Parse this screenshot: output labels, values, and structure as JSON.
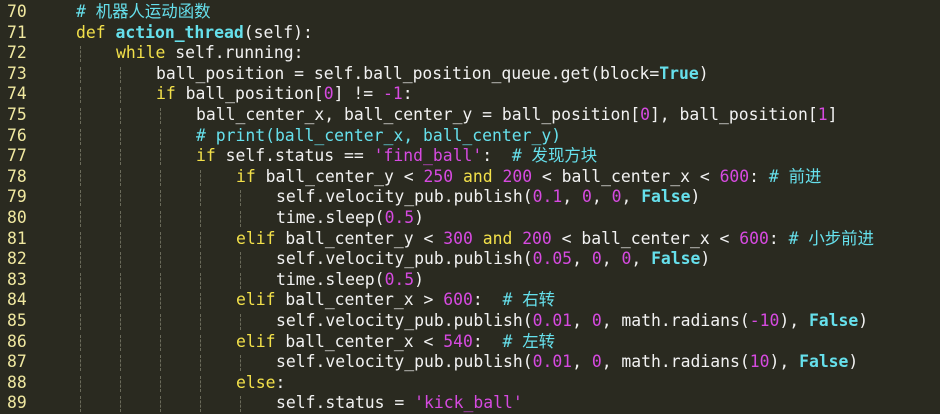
{
  "editor": {
    "colors": {
      "background": "#2a2a20",
      "line_number": "#f0e8a0",
      "keyword": "#f2e04a",
      "function": "#66e0ec",
      "constant": "#66e0ec",
      "number": "#d64ae0",
      "string": "#d64ae0",
      "comment": "#66e0ec",
      "text": "#f2f2f2"
    },
    "lines": [
      {
        "num": "70",
        "indent": 0,
        "tokens": [
          {
            "t": "cm",
            "v": "# 机器人运动函数"
          }
        ]
      },
      {
        "num": "71",
        "indent": 0,
        "tokens": [
          {
            "t": "kw",
            "v": "def "
          },
          {
            "t": "fn",
            "v": "action_thread"
          },
          {
            "t": "plain",
            "v": "(self):"
          }
        ]
      },
      {
        "num": "72",
        "indent": 1,
        "tokens": [
          {
            "t": "kw",
            "v": "while "
          },
          {
            "t": "plain",
            "v": "self.running:"
          }
        ]
      },
      {
        "num": "73",
        "indent": 2,
        "tokens": [
          {
            "t": "plain",
            "v": "ball_position = self.ball_position_queue.get(block="
          },
          {
            "t": "const",
            "v": "True"
          },
          {
            "t": "plain",
            "v": ")"
          }
        ]
      },
      {
        "num": "74",
        "indent": 2,
        "tokens": [
          {
            "t": "kw",
            "v": "if "
          },
          {
            "t": "plain",
            "v": "ball_position["
          },
          {
            "t": "num",
            "v": "0"
          },
          {
            "t": "plain",
            "v": "] != "
          },
          {
            "t": "num",
            "v": "-1"
          },
          {
            "t": "plain",
            "v": ":"
          }
        ]
      },
      {
        "num": "75",
        "indent": 3,
        "tokens": [
          {
            "t": "plain",
            "v": "ball_center_x, ball_center_y = ball_position["
          },
          {
            "t": "num",
            "v": "0"
          },
          {
            "t": "plain",
            "v": "], ball_position["
          },
          {
            "t": "num",
            "v": "1"
          },
          {
            "t": "plain",
            "v": "]"
          }
        ]
      },
      {
        "num": "76",
        "indent": 3,
        "tokens": [
          {
            "t": "cm",
            "v": "# print(ball_center_x, ball_center_y)"
          }
        ]
      },
      {
        "num": "77",
        "indent": 3,
        "tokens": [
          {
            "t": "kw",
            "v": "if "
          },
          {
            "t": "plain",
            "v": "self.status == "
          },
          {
            "t": "str",
            "v": "'find_ball'"
          },
          {
            "t": "plain",
            "v": ":  "
          },
          {
            "t": "cm",
            "v": "# 发现方块"
          }
        ]
      },
      {
        "num": "78",
        "indent": 4,
        "tokens": [
          {
            "t": "kw",
            "v": "if "
          },
          {
            "t": "plain",
            "v": "ball_center_y < "
          },
          {
            "t": "num",
            "v": "250"
          },
          {
            "t": "kw",
            "v": " and "
          },
          {
            "t": "num",
            "v": "200"
          },
          {
            "t": "plain",
            "v": " < ball_center_x < "
          },
          {
            "t": "num",
            "v": "600"
          },
          {
            "t": "plain",
            "v": ": "
          },
          {
            "t": "cm",
            "v": "# 前进"
          }
        ]
      },
      {
        "num": "79",
        "indent": 5,
        "tokens": [
          {
            "t": "plain",
            "v": "self.velocity_pub.publish("
          },
          {
            "t": "num",
            "v": "0.1"
          },
          {
            "t": "plain",
            "v": ", "
          },
          {
            "t": "num",
            "v": "0"
          },
          {
            "t": "plain",
            "v": ", "
          },
          {
            "t": "num",
            "v": "0"
          },
          {
            "t": "plain",
            "v": ", "
          },
          {
            "t": "const",
            "v": "False"
          },
          {
            "t": "plain",
            "v": ")"
          }
        ]
      },
      {
        "num": "80",
        "indent": 5,
        "tokens": [
          {
            "t": "plain",
            "v": "time.sleep("
          },
          {
            "t": "num",
            "v": "0.5"
          },
          {
            "t": "plain",
            "v": ")"
          }
        ]
      },
      {
        "num": "81",
        "indent": 4,
        "tokens": [
          {
            "t": "kw",
            "v": "elif "
          },
          {
            "t": "plain",
            "v": "ball_center_y < "
          },
          {
            "t": "num",
            "v": "300"
          },
          {
            "t": "kw",
            "v": " and "
          },
          {
            "t": "num",
            "v": "200"
          },
          {
            "t": "plain",
            "v": " < ball_center_x < "
          },
          {
            "t": "num",
            "v": "600"
          },
          {
            "t": "plain",
            "v": ": "
          },
          {
            "t": "cm",
            "v": "# 小步前进"
          }
        ]
      },
      {
        "num": "82",
        "indent": 5,
        "tokens": [
          {
            "t": "plain",
            "v": "self.velocity_pub.publish("
          },
          {
            "t": "num",
            "v": "0.05"
          },
          {
            "t": "plain",
            "v": ", "
          },
          {
            "t": "num",
            "v": "0"
          },
          {
            "t": "plain",
            "v": ", "
          },
          {
            "t": "num",
            "v": "0"
          },
          {
            "t": "plain",
            "v": ", "
          },
          {
            "t": "const",
            "v": "False"
          },
          {
            "t": "plain",
            "v": ")"
          }
        ]
      },
      {
        "num": "83",
        "indent": 5,
        "tokens": [
          {
            "t": "plain",
            "v": "time.sleep("
          },
          {
            "t": "num",
            "v": "0.5"
          },
          {
            "t": "plain",
            "v": ")"
          }
        ]
      },
      {
        "num": "84",
        "indent": 4,
        "tokens": [
          {
            "t": "kw",
            "v": "elif "
          },
          {
            "t": "plain",
            "v": "ball_center_x > "
          },
          {
            "t": "num",
            "v": "600"
          },
          {
            "t": "plain",
            "v": ":  "
          },
          {
            "t": "cm",
            "v": "# 右转"
          }
        ]
      },
      {
        "num": "85",
        "indent": 5,
        "tokens": [
          {
            "t": "plain",
            "v": "self.velocity_pub.publish("
          },
          {
            "t": "num",
            "v": "0.01"
          },
          {
            "t": "plain",
            "v": ", "
          },
          {
            "t": "num",
            "v": "0"
          },
          {
            "t": "plain",
            "v": ", math.radians("
          },
          {
            "t": "num",
            "v": "-10"
          },
          {
            "t": "plain",
            "v": "), "
          },
          {
            "t": "const",
            "v": "False"
          },
          {
            "t": "plain",
            "v": ")"
          }
        ]
      },
      {
        "num": "86",
        "indent": 4,
        "tokens": [
          {
            "t": "kw",
            "v": "elif "
          },
          {
            "t": "plain",
            "v": "ball_center_x < "
          },
          {
            "t": "num",
            "v": "540"
          },
          {
            "t": "plain",
            "v": ":  "
          },
          {
            "t": "cm",
            "v": "# 左转"
          }
        ]
      },
      {
        "num": "87",
        "indent": 5,
        "tokens": [
          {
            "t": "plain",
            "v": "self.velocity_pub.publish("
          },
          {
            "t": "num",
            "v": "0.01"
          },
          {
            "t": "plain",
            "v": ", "
          },
          {
            "t": "num",
            "v": "0"
          },
          {
            "t": "plain",
            "v": ", math.radians("
          },
          {
            "t": "num",
            "v": "10"
          },
          {
            "t": "plain",
            "v": "), "
          },
          {
            "t": "const",
            "v": "False"
          },
          {
            "t": "plain",
            "v": ")"
          }
        ]
      },
      {
        "num": "88",
        "indent": 4,
        "tokens": [
          {
            "t": "kw",
            "v": "else"
          },
          {
            "t": "plain",
            "v": ":"
          }
        ]
      },
      {
        "num": "89",
        "indent": 5,
        "tokens": [
          {
            "t": "plain",
            "v": "self.status = "
          },
          {
            "t": "str",
            "v": "'kick_ball'"
          }
        ]
      }
    ]
  }
}
